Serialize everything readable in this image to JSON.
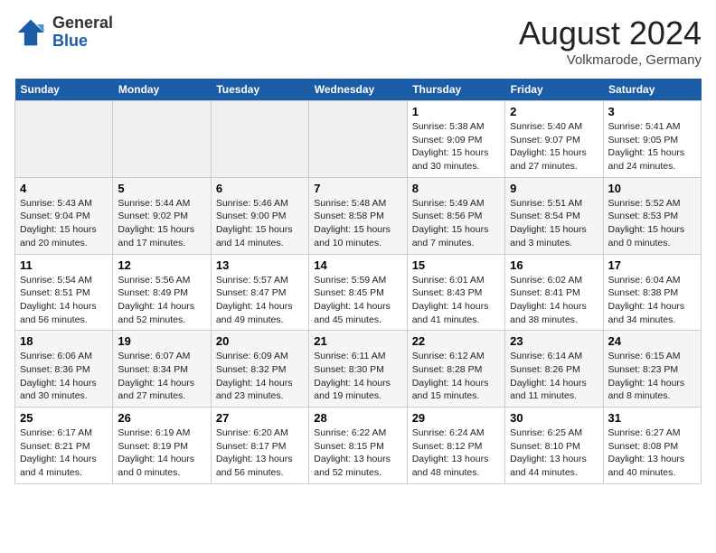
{
  "header": {
    "logo_general": "General",
    "logo_blue": "Blue",
    "month": "August 2024",
    "location": "Volkmarode, Germany"
  },
  "weekdays": [
    "Sunday",
    "Monday",
    "Tuesday",
    "Wednesday",
    "Thursday",
    "Friday",
    "Saturday"
  ],
  "weeks": [
    [
      {
        "day": "",
        "info": ""
      },
      {
        "day": "",
        "info": ""
      },
      {
        "day": "",
        "info": ""
      },
      {
        "day": "",
        "info": ""
      },
      {
        "day": "1",
        "info": "Sunrise: 5:38 AM\nSunset: 9:09 PM\nDaylight: 15 hours\nand 30 minutes."
      },
      {
        "day": "2",
        "info": "Sunrise: 5:40 AM\nSunset: 9:07 PM\nDaylight: 15 hours\nand 27 minutes."
      },
      {
        "day": "3",
        "info": "Sunrise: 5:41 AM\nSunset: 9:05 PM\nDaylight: 15 hours\nand 24 minutes."
      }
    ],
    [
      {
        "day": "4",
        "info": "Sunrise: 5:43 AM\nSunset: 9:04 PM\nDaylight: 15 hours\nand 20 minutes."
      },
      {
        "day": "5",
        "info": "Sunrise: 5:44 AM\nSunset: 9:02 PM\nDaylight: 15 hours\nand 17 minutes."
      },
      {
        "day": "6",
        "info": "Sunrise: 5:46 AM\nSunset: 9:00 PM\nDaylight: 15 hours\nand 14 minutes."
      },
      {
        "day": "7",
        "info": "Sunrise: 5:48 AM\nSunset: 8:58 PM\nDaylight: 15 hours\nand 10 minutes."
      },
      {
        "day": "8",
        "info": "Sunrise: 5:49 AM\nSunset: 8:56 PM\nDaylight: 15 hours\nand 7 minutes."
      },
      {
        "day": "9",
        "info": "Sunrise: 5:51 AM\nSunset: 8:54 PM\nDaylight: 15 hours\nand 3 minutes."
      },
      {
        "day": "10",
        "info": "Sunrise: 5:52 AM\nSunset: 8:53 PM\nDaylight: 15 hours\nand 0 minutes."
      }
    ],
    [
      {
        "day": "11",
        "info": "Sunrise: 5:54 AM\nSunset: 8:51 PM\nDaylight: 14 hours\nand 56 minutes."
      },
      {
        "day": "12",
        "info": "Sunrise: 5:56 AM\nSunset: 8:49 PM\nDaylight: 14 hours\nand 52 minutes."
      },
      {
        "day": "13",
        "info": "Sunrise: 5:57 AM\nSunset: 8:47 PM\nDaylight: 14 hours\nand 49 minutes."
      },
      {
        "day": "14",
        "info": "Sunrise: 5:59 AM\nSunset: 8:45 PM\nDaylight: 14 hours\nand 45 minutes."
      },
      {
        "day": "15",
        "info": "Sunrise: 6:01 AM\nSunset: 8:43 PM\nDaylight: 14 hours\nand 41 minutes."
      },
      {
        "day": "16",
        "info": "Sunrise: 6:02 AM\nSunset: 8:41 PM\nDaylight: 14 hours\nand 38 minutes."
      },
      {
        "day": "17",
        "info": "Sunrise: 6:04 AM\nSunset: 8:38 PM\nDaylight: 14 hours\nand 34 minutes."
      }
    ],
    [
      {
        "day": "18",
        "info": "Sunrise: 6:06 AM\nSunset: 8:36 PM\nDaylight: 14 hours\nand 30 minutes."
      },
      {
        "day": "19",
        "info": "Sunrise: 6:07 AM\nSunset: 8:34 PM\nDaylight: 14 hours\nand 27 minutes."
      },
      {
        "day": "20",
        "info": "Sunrise: 6:09 AM\nSunset: 8:32 PM\nDaylight: 14 hours\nand 23 minutes."
      },
      {
        "day": "21",
        "info": "Sunrise: 6:11 AM\nSunset: 8:30 PM\nDaylight: 14 hours\nand 19 minutes."
      },
      {
        "day": "22",
        "info": "Sunrise: 6:12 AM\nSunset: 8:28 PM\nDaylight: 14 hours\nand 15 minutes."
      },
      {
        "day": "23",
        "info": "Sunrise: 6:14 AM\nSunset: 8:26 PM\nDaylight: 14 hours\nand 11 minutes."
      },
      {
        "day": "24",
        "info": "Sunrise: 6:15 AM\nSunset: 8:23 PM\nDaylight: 14 hours\nand 8 minutes."
      }
    ],
    [
      {
        "day": "25",
        "info": "Sunrise: 6:17 AM\nSunset: 8:21 PM\nDaylight: 14 hours\nand 4 minutes."
      },
      {
        "day": "26",
        "info": "Sunrise: 6:19 AM\nSunset: 8:19 PM\nDaylight: 14 hours\nand 0 minutes."
      },
      {
        "day": "27",
        "info": "Sunrise: 6:20 AM\nSunset: 8:17 PM\nDaylight: 13 hours\nand 56 minutes."
      },
      {
        "day": "28",
        "info": "Sunrise: 6:22 AM\nSunset: 8:15 PM\nDaylight: 13 hours\nand 52 minutes."
      },
      {
        "day": "29",
        "info": "Sunrise: 6:24 AM\nSunset: 8:12 PM\nDaylight: 13 hours\nand 48 minutes."
      },
      {
        "day": "30",
        "info": "Sunrise: 6:25 AM\nSunset: 8:10 PM\nDaylight: 13 hours\nand 44 minutes."
      },
      {
        "day": "31",
        "info": "Sunrise: 6:27 AM\nSunset: 8:08 PM\nDaylight: 13 hours\nand 40 minutes."
      }
    ]
  ]
}
